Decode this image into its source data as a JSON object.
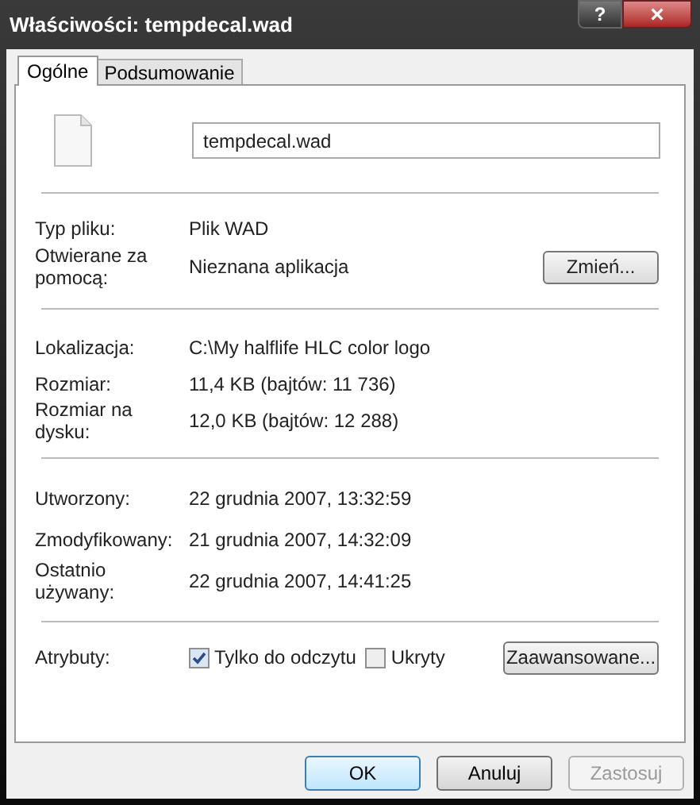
{
  "window": {
    "title": "Właściwości: tempdecal.wad",
    "help": "?",
    "close": "×"
  },
  "tabs": [
    {
      "label": "Ogólne",
      "selected": true
    },
    {
      "label": "Podsumowanie",
      "selected": false
    }
  ],
  "file_name": "tempdecal.wad",
  "sections": [
    [
      {
        "label": "Typ pliku:",
        "value": "Plik WAD"
      },
      {
        "label": "Otwierane za pomocą:",
        "value": "Nieznana aplikacja",
        "button": "Zmień..."
      }
    ],
    [
      {
        "label": "Lokalizacja:",
        "value": "C:\\My halflife HLC color logo"
      },
      {
        "label": "Rozmiar:",
        "value": "11,4 KB (bajtów: 11 736)"
      },
      {
        "label": "Rozmiar na dysku:",
        "value": "12,0 KB (bajtów: 12 288)"
      }
    ],
    [
      {
        "label": "Utworzony:",
        "value": "22 grudnia 2007, 13:32:59"
      },
      {
        "label": "Zmodyfikowany:",
        "value": "21 grudnia 2007, 14:32:09"
      },
      {
        "label": "Ostatnio używany:",
        "value": "22 grudnia 2007, 14:41:25"
      }
    ]
  ],
  "attributes": {
    "label": "Atrybuty:",
    "checkboxes": [
      {
        "label": "Tylko do odczytu",
        "checked": true
      },
      {
        "label": "Ukryty",
        "checked": false
      }
    ],
    "button": "Zaawansowane..."
  },
  "buttons": [
    {
      "label": "OK",
      "kind": "default",
      "disabled": false
    },
    {
      "label": "Anuluj",
      "kind": "normal",
      "disabled": false
    },
    {
      "label": "Zastosuj",
      "kind": "normal",
      "disabled": true
    }
  ]
}
